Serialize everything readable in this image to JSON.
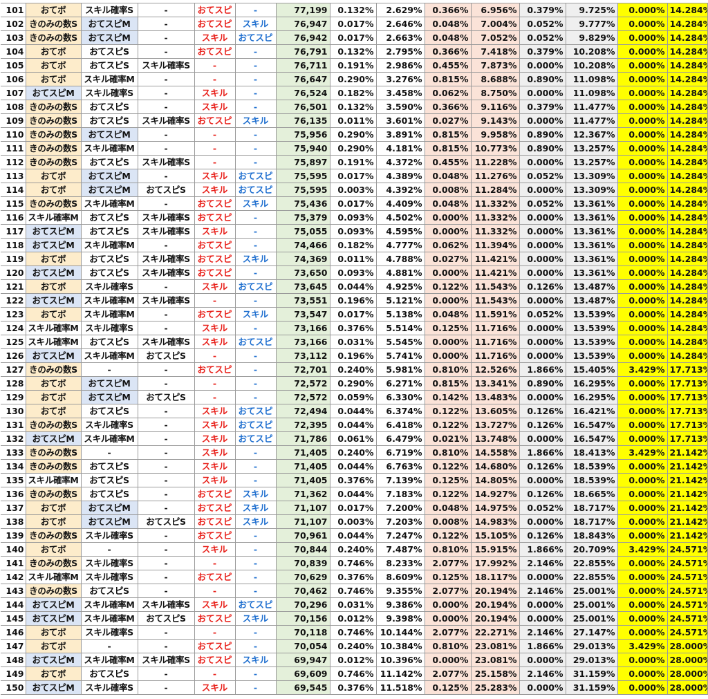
{
  "columns": [
    "rank",
    "skill1",
    "skill2",
    "skill3",
    "skill4",
    "skill5",
    "score",
    "p1",
    "c1",
    "p2",
    "c2",
    "p3",
    "c3",
    "p4",
    "c4"
  ],
  "colors": {
    "red_text": "#e8201a",
    "blue_text": "#1f6fcf",
    "orange_cell": "#fdeccb",
    "blue_cell": "#dbe5f5",
    "green_cell": "#e4f0da",
    "peach_cell": "#fbe3d8",
    "gray_cell": "#efefef",
    "yellow_cell": "#ffff00"
  },
  "rows": [
    [
      "101",
      "おてボ",
      "スキル確率S",
      "-",
      "おてスピ",
      "-",
      "77,199",
      "0.132%",
      "2.629%",
      "0.366%",
      "6.956%",
      "0.379%",
      "9.725%",
      "0.000%",
      "14.284%"
    ],
    [
      "102",
      "きのみの数S",
      "おてスピM",
      "-",
      "おてスピ",
      "スキル",
      "76,947",
      "0.017%",
      "2.646%",
      "0.048%",
      "7.004%",
      "0.052%",
      "9.777%",
      "0.000%",
      "14.284%"
    ],
    [
      "103",
      "きのみの数S",
      "おてスピM",
      "-",
      "スキル",
      "おてスピ",
      "76,942",
      "0.017%",
      "2.663%",
      "0.048%",
      "7.052%",
      "0.052%",
      "9.829%",
      "0.000%",
      "14.284%"
    ],
    [
      "104",
      "おてボ",
      "おてスピS",
      "-",
      "おてスピ",
      "-",
      "76,791",
      "0.132%",
      "2.795%",
      "0.366%",
      "7.418%",
      "0.379%",
      "10.208%",
      "0.000%",
      "14.284%"
    ],
    [
      "105",
      "おてボ",
      "おてスピS",
      "スキル確率S",
      "-",
      "-",
      "76,711",
      "0.191%",
      "2.986%",
      "0.455%",
      "7.873%",
      "0.000%",
      "10.208%",
      "0.000%",
      "14.284%"
    ],
    [
      "106",
      "おてボ",
      "スキル確率M",
      "-",
      "-",
      "-",
      "76,647",
      "0.290%",
      "3.276%",
      "0.815%",
      "8.688%",
      "0.890%",
      "11.098%",
      "0.000%",
      "14.284%"
    ],
    [
      "107",
      "おてスピM",
      "スキル確率S",
      "-",
      "スキル",
      "-",
      "76,524",
      "0.182%",
      "3.458%",
      "0.062%",
      "8.750%",
      "0.000%",
      "11.098%",
      "0.000%",
      "14.284%"
    ],
    [
      "108",
      "きのみの数S",
      "おてスピS",
      "-",
      "スキル",
      "-",
      "76,501",
      "0.132%",
      "3.590%",
      "0.366%",
      "9.116%",
      "0.379%",
      "11.477%",
      "0.000%",
      "14.284%"
    ],
    [
      "109",
      "きのみの数S",
      "おてスピS",
      "スキル確率S",
      "おてスピ",
      "スキル",
      "76,135",
      "0.011%",
      "3.601%",
      "0.027%",
      "9.143%",
      "0.000%",
      "11.477%",
      "0.000%",
      "14.284%"
    ],
    [
      "110",
      "きのみの数S",
      "おてスピM",
      "-",
      "-",
      "-",
      "75,956",
      "0.290%",
      "3.891%",
      "0.815%",
      "9.958%",
      "0.890%",
      "12.367%",
      "0.000%",
      "14.284%"
    ],
    [
      "111",
      "きのみの数S",
      "スキル確率M",
      "-",
      "-",
      "-",
      "75,940",
      "0.290%",
      "4.181%",
      "0.815%",
      "10.773%",
      "0.890%",
      "13.257%",
      "0.000%",
      "14.284%"
    ],
    [
      "112",
      "きのみの数S",
      "おてスピS",
      "スキル確率S",
      "-",
      "-",
      "75,897",
      "0.191%",
      "4.372%",
      "0.455%",
      "11.228%",
      "0.000%",
      "13.257%",
      "0.000%",
      "14.284%"
    ],
    [
      "113",
      "おてボ",
      "おてスピM",
      "-",
      "スキル",
      "おてスピ",
      "75,595",
      "0.017%",
      "4.389%",
      "0.048%",
      "11.276%",
      "0.052%",
      "13.309%",
      "0.000%",
      "14.284%"
    ],
    [
      "114",
      "おてボ",
      "おてスピM",
      "おてスピS",
      "スキル",
      "おてスピ",
      "75,595",
      "0.003%",
      "4.392%",
      "0.008%",
      "11.284%",
      "0.000%",
      "13.309%",
      "0.000%",
      "14.284%"
    ],
    [
      "115",
      "きのみの数S",
      "スキル確率M",
      "-",
      "おてスピ",
      "スキル",
      "75,436",
      "0.017%",
      "4.409%",
      "0.048%",
      "11.332%",
      "0.052%",
      "13.361%",
      "0.000%",
      "14.284%"
    ],
    [
      "116",
      "スキル確率M",
      "おてスピS",
      "スキル確率S",
      "おてスピ",
      "-",
      "75,379",
      "0.093%",
      "4.502%",
      "0.000%",
      "11.332%",
      "0.000%",
      "13.361%",
      "0.000%",
      "14.284%"
    ],
    [
      "117",
      "おてスピM",
      "おてスピS",
      "スキル確率S",
      "スキル",
      "-",
      "75,055",
      "0.093%",
      "4.595%",
      "0.000%",
      "11.332%",
      "0.000%",
      "13.361%",
      "0.000%",
      "14.284%"
    ],
    [
      "118",
      "おてスピM",
      "スキル確率M",
      "-",
      "おてスピ",
      "-",
      "74,466",
      "0.182%",
      "4.777%",
      "0.062%",
      "11.394%",
      "0.000%",
      "13.361%",
      "0.000%",
      "14.284%"
    ],
    [
      "119",
      "おてボ",
      "おてスピS",
      "スキル確率S",
      "おてスピ",
      "スキル",
      "74,369",
      "0.011%",
      "4.788%",
      "0.027%",
      "11.421%",
      "0.000%",
      "13.361%",
      "0.000%",
      "14.284%"
    ],
    [
      "120",
      "おてスピM",
      "おてスピS",
      "スキル確率S",
      "おてスピ",
      "-",
      "73,650",
      "0.093%",
      "4.881%",
      "0.000%",
      "11.421%",
      "0.000%",
      "13.361%",
      "0.000%",
      "14.284%"
    ],
    [
      "121",
      "おてボ",
      "スキル確率S",
      "-",
      "スキル",
      "おてスピ",
      "73,645",
      "0.044%",
      "4.925%",
      "0.122%",
      "11.543%",
      "0.126%",
      "13.487%",
      "0.000%",
      "14.284%"
    ],
    [
      "122",
      "おてスピM",
      "スキル確率M",
      "スキル確率S",
      "-",
      "-",
      "73,551",
      "0.196%",
      "5.121%",
      "0.000%",
      "11.543%",
      "0.000%",
      "13.487%",
      "0.000%",
      "14.284%"
    ],
    [
      "123",
      "おてボ",
      "スキル確率M",
      "-",
      "おてスピ",
      "スキル",
      "73,547",
      "0.017%",
      "5.138%",
      "0.048%",
      "11.591%",
      "0.052%",
      "13.539%",
      "0.000%",
      "14.284%"
    ],
    [
      "124",
      "スキル確率M",
      "スキル確率S",
      "-",
      "スキル",
      "-",
      "73,166",
      "0.376%",
      "5.514%",
      "0.125%",
      "11.716%",
      "0.000%",
      "13.539%",
      "0.000%",
      "14.284%"
    ],
    [
      "125",
      "スキル確率M",
      "おてスピS",
      "スキル確率S",
      "スキル",
      "おてスピ",
      "73,166",
      "0.031%",
      "5.545%",
      "0.000%",
      "11.716%",
      "0.000%",
      "13.539%",
      "0.000%",
      "14.284%"
    ],
    [
      "126",
      "おてスピM",
      "スキル確率M",
      "おてスピS",
      "-",
      "-",
      "73,112",
      "0.196%",
      "5.741%",
      "0.000%",
      "11.716%",
      "0.000%",
      "13.539%",
      "0.000%",
      "14.284%"
    ],
    [
      "127",
      "きのみの数S",
      "-",
      "-",
      "おてスピ",
      "-",
      "72,701",
      "0.240%",
      "5.981%",
      "0.810%",
      "12.526%",
      "1.866%",
      "15.405%",
      "3.429%",
      "17.713%"
    ],
    [
      "128",
      "おてボ",
      "おてスピM",
      "-",
      "-",
      "-",
      "72,572",
      "0.290%",
      "6.271%",
      "0.815%",
      "13.341%",
      "0.890%",
      "16.295%",
      "0.000%",
      "17.713%"
    ],
    [
      "129",
      "おてボ",
      "おてスピM",
      "おてスピS",
      "-",
      "-",
      "72,572",
      "0.059%",
      "6.330%",
      "0.142%",
      "13.483%",
      "0.000%",
      "16.295%",
      "0.000%",
      "17.713%"
    ],
    [
      "130",
      "おてボ",
      "おてスピS",
      "-",
      "スキル",
      "おてスピ",
      "72,494",
      "0.044%",
      "6.374%",
      "0.122%",
      "13.605%",
      "0.126%",
      "16.421%",
      "0.000%",
      "17.713%"
    ],
    [
      "131",
      "きのみの数S",
      "スキル確率S",
      "-",
      "スキル",
      "おてスピ",
      "72,395",
      "0.044%",
      "6.418%",
      "0.122%",
      "13.727%",
      "0.126%",
      "16.547%",
      "0.000%",
      "17.713%"
    ],
    [
      "132",
      "おてスピM",
      "スキル確率M",
      "-",
      "スキル",
      "おてスピ",
      "71,786",
      "0.061%",
      "6.479%",
      "0.021%",
      "13.748%",
      "0.000%",
      "16.547%",
      "0.000%",
      "17.713%"
    ],
    [
      "133",
      "きのみの数S",
      "-",
      "-",
      "スキル",
      "-",
      "71,405",
      "0.240%",
      "6.719%",
      "0.810%",
      "14.558%",
      "1.866%",
      "18.413%",
      "3.429%",
      "21.142%"
    ],
    [
      "134",
      "きのみの数S",
      "おてスピS",
      "-",
      "スキル",
      "-",
      "71,405",
      "0.044%",
      "6.763%",
      "0.122%",
      "14.680%",
      "0.126%",
      "18.539%",
      "0.000%",
      "21.142%"
    ],
    [
      "135",
      "スキル確率M",
      "おてスピS",
      "-",
      "スキル",
      "-",
      "71,405",
      "0.376%",
      "7.139%",
      "0.125%",
      "14.805%",
      "0.000%",
      "18.539%",
      "0.000%",
      "21.142%"
    ],
    [
      "136",
      "きのみの数S",
      "おてスピS",
      "-",
      "おてスピ",
      "スキル",
      "71,362",
      "0.044%",
      "7.183%",
      "0.122%",
      "14.927%",
      "0.126%",
      "18.665%",
      "0.000%",
      "21.142%"
    ],
    [
      "137",
      "おてボ",
      "おてスピM",
      "-",
      "おてスピ",
      "スキル",
      "71,107",
      "0.017%",
      "7.200%",
      "0.048%",
      "14.975%",
      "0.052%",
      "18.717%",
      "0.000%",
      "21.142%"
    ],
    [
      "138",
      "おてボ",
      "おてスピM",
      "おてスピS",
      "おてスピ",
      "スキル",
      "71,107",
      "0.003%",
      "7.203%",
      "0.008%",
      "14.983%",
      "0.000%",
      "18.717%",
      "0.000%",
      "21.142%"
    ],
    [
      "139",
      "きのみの数S",
      "スキル確率S",
      "-",
      "おてスピ",
      "-",
      "70,961",
      "0.044%",
      "7.247%",
      "0.122%",
      "15.105%",
      "0.126%",
      "18.843%",
      "0.000%",
      "21.142%"
    ],
    [
      "140",
      "おてボ",
      "-",
      "-",
      "スキル",
      "-",
      "70,844",
      "0.240%",
      "7.487%",
      "0.810%",
      "15.915%",
      "1.866%",
      "20.709%",
      "3.429%",
      "24.571%"
    ],
    [
      "141",
      "きのみの数S",
      "スキル確率S",
      "-",
      "-",
      "-",
      "70,839",
      "0.746%",
      "8.233%",
      "2.077%",
      "17.992%",
      "2.146%",
      "22.855%",
      "0.000%",
      "24.571%"
    ],
    [
      "142",
      "スキル確率M",
      "スキル確率S",
      "-",
      "おてスピ",
      "-",
      "70,629",
      "0.376%",
      "8.609%",
      "0.125%",
      "18.117%",
      "0.000%",
      "22.855%",
      "0.000%",
      "24.571%"
    ],
    [
      "143",
      "きのみの数S",
      "おてスピS",
      "-",
      "-",
      "-",
      "70,462",
      "0.746%",
      "9.355%",
      "2.077%",
      "20.194%",
      "2.146%",
      "25.001%",
      "0.000%",
      "24.571%"
    ],
    [
      "144",
      "おてスピM",
      "スキル確率M",
      "スキル確率S",
      "スキル",
      "おてスピ",
      "70,296",
      "0.031%",
      "9.386%",
      "0.000%",
      "20.194%",
      "0.000%",
      "25.001%",
      "0.000%",
      "24.571%"
    ],
    [
      "145",
      "おてスピM",
      "スキル確率M",
      "おてスピS",
      "おてスピ",
      "スキル",
      "70,156",
      "0.012%",
      "9.398%",
      "0.000%",
      "20.194%",
      "0.000%",
      "25.001%",
      "0.000%",
      "24.571%"
    ],
    [
      "146",
      "おてボ",
      "スキル確率S",
      "-",
      "-",
      "-",
      "70,118",
      "0.746%",
      "10.144%",
      "2.077%",
      "22.271%",
      "2.146%",
      "27.147%",
      "0.000%",
      "24.571%"
    ],
    [
      "147",
      "おてボ",
      "-",
      "-",
      "おてスピ",
      "-",
      "70,054",
      "0.240%",
      "10.384%",
      "0.810%",
      "23.081%",
      "1.866%",
      "29.013%",
      "3.429%",
      "28.000%"
    ],
    [
      "148",
      "おてスピM",
      "スキル確率M",
      "スキル確率S",
      "おてスピ",
      "スキル",
      "69,947",
      "0.012%",
      "10.396%",
      "0.000%",
      "23.081%",
      "0.000%",
      "29.013%",
      "0.000%",
      "28.000%"
    ],
    [
      "149",
      "おてボ",
      "おてスピS",
      "-",
      "-",
      "-",
      "69,609",
      "0.746%",
      "11.142%",
      "2.077%",
      "25.158%",
      "2.146%",
      "31.159%",
      "0.000%",
      "28.000%"
    ],
    [
      "150",
      "おてスピM",
      "スキル確率S",
      "-",
      "スキル",
      "-",
      "69,545",
      "0.376%",
      "11.518%",
      "0.125%",
      "25.283%",
      "0.000%",
      "31.159%",
      "0.000%",
      "28.000%"
    ]
  ]
}
